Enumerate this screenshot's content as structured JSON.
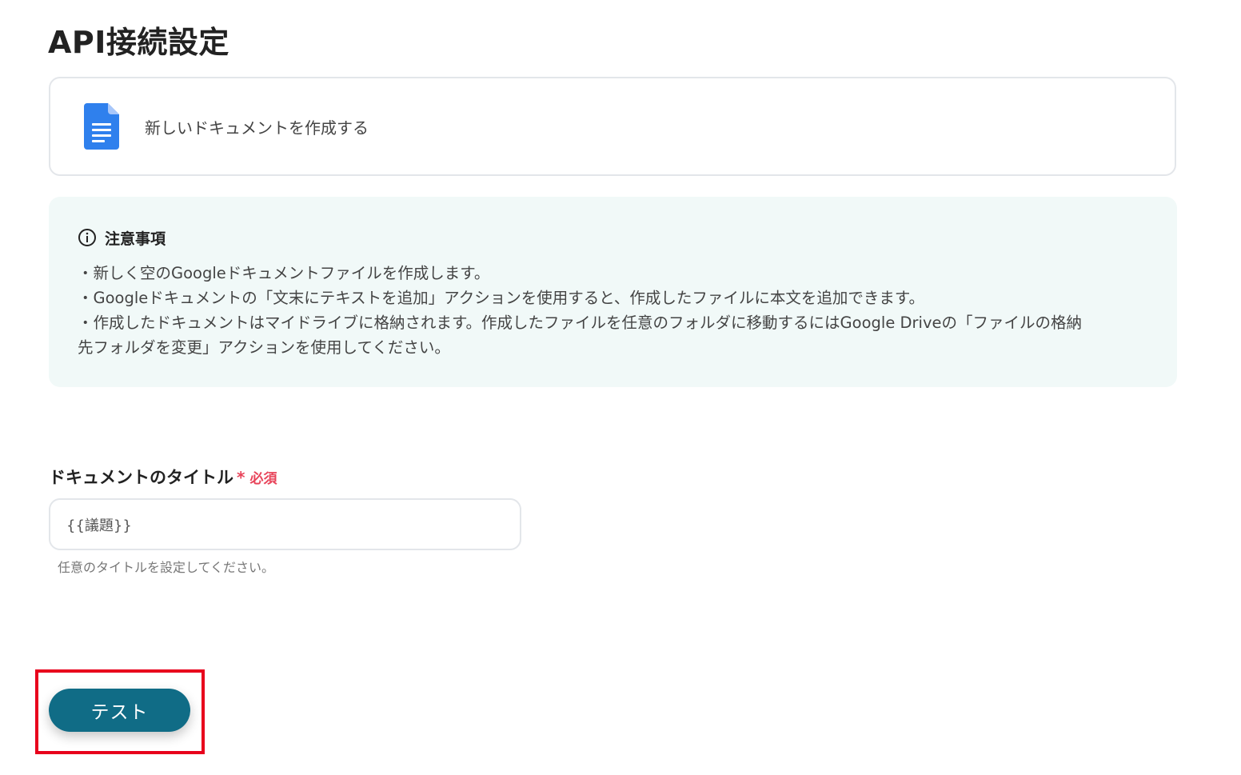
{
  "page": {
    "title": "API接続設定"
  },
  "action": {
    "icon": "google-docs-icon",
    "label": "新しいドキュメントを作成する"
  },
  "notice": {
    "icon": "info-icon",
    "heading": "注意事項",
    "lines": [
      "・新しく空のGoogleドキュメントファイルを作成します。",
      "・Googleドキュメントの「文末にテキストを追加」アクションを使用すると、作成したファイルに本文を追加できます。",
      "・作成したドキュメントはマイドライブに格納されます。作成したファイルを任意のフォルダに移動するにはGoogle Driveの「ファイルの格納",
      "先フォルダを変更」アクションを使用してください。"
    ],
    "background_color": "#f1f9f8"
  },
  "field": {
    "label": "ドキュメントのタイトル",
    "required_star": "*",
    "required_label": "必須",
    "value": "{{議題}}",
    "helper": "任意のタイトルを設定してください。"
  },
  "test_button": {
    "label": "テスト",
    "color": "#106c86"
  },
  "colors": {
    "required": "#e8445a",
    "highlight": "#e8001c",
    "docs_blue": "#2f80ed"
  }
}
